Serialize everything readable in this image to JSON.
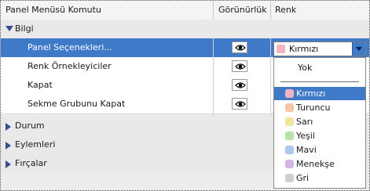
{
  "header": {
    "col_command": "Panel Menüsü Komutu",
    "col_visibility": "Görünürlük",
    "col_color": "Renk"
  },
  "rows": [
    {
      "type": "category",
      "label": "Bilgi",
      "expanded": true
    },
    {
      "type": "item",
      "label": "Panel Seçenekleri...",
      "selected": true
    },
    {
      "type": "item",
      "label": "Renk Örnekleyiciler"
    },
    {
      "type": "item",
      "label": "Kapat"
    },
    {
      "type": "item",
      "label": "Sekme Grubunu Kapat"
    },
    {
      "type": "category",
      "label": "Durum",
      "expanded": false
    },
    {
      "type": "category",
      "label": "Eylemleri",
      "expanded": false
    },
    {
      "type": "category",
      "label": "Fırçalar",
      "expanded": false
    }
  ],
  "icons": {
    "visibility": "eye-icon",
    "expand": "triangle-down-icon",
    "collapse": "triangle-right-icon",
    "dropdown": "chevron-down-icon"
  },
  "color_select": {
    "value": "Kırmızı",
    "swatch": "#f4b4c4"
  },
  "color_options": [
    {
      "label": "Yok",
      "swatch": null
    },
    {
      "label": "Kırmızı",
      "swatch": "#f4b4c4",
      "active": true
    },
    {
      "label": "Turuncu",
      "swatch": "#f6c6a6"
    },
    {
      "label": "Sarı",
      "swatch": "#f1e4a0"
    },
    {
      "label": "Yeşil",
      "swatch": "#b7e2a8"
    },
    {
      "label": "Mavi",
      "swatch": "#a9c9ef"
    },
    {
      "label": "Menekşe",
      "swatch": "#d2b7e6"
    },
    {
      "label": "Gri",
      "swatch": "#cfcfcf"
    }
  ],
  "colors": {
    "selection": "#3f7ac9",
    "category_bg": "#e9e9e9",
    "item_bg": "#ffffff"
  }
}
